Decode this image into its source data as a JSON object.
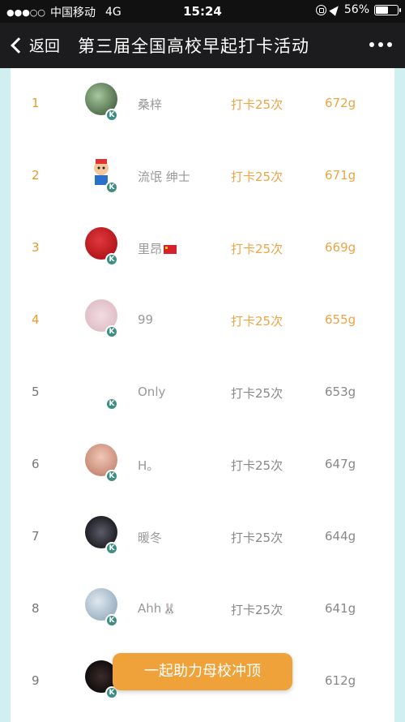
{
  "status_bar": {
    "signal": "●●●○○",
    "carrier": "中国移动",
    "network": "4G",
    "time": "15:24",
    "battery": "56%",
    "battery_level": 0.56
  },
  "nav": {
    "back_label": "返回",
    "title": "第三届全国高校早起打卡活动"
  },
  "rows": [
    {
      "rank": "1",
      "name": "桑梓",
      "checkin": "打卡25次",
      "grams": "672g"
    },
    {
      "rank": "2",
      "name": "流氓 绅士",
      "checkin": "打卡25次",
      "grams": "671g"
    },
    {
      "rank": "3",
      "name": "里昂",
      "checkin": "打卡25次",
      "grams": "669g"
    },
    {
      "rank": "4",
      "name": "99",
      "checkin": "打卡25次",
      "grams": "655g"
    },
    {
      "rank": "5",
      "name": "Only",
      "checkin": "打卡25次",
      "grams": "653g"
    },
    {
      "rank": "6",
      "name": "H。",
      "checkin": "打卡25次",
      "grams": "647g"
    },
    {
      "rank": "7",
      "name": "暖冬",
      "checkin": "打卡25次",
      "grams": "644g"
    },
    {
      "rank": "8",
      "name": "Ahh",
      "checkin": "打卡25次",
      "grams": "641g"
    },
    {
      "rank": "9",
      "name": "",
      "checkin": "",
      "grams": "612g"
    }
  ],
  "badge_letter": "K",
  "float_button": {
    "label": "一起助力母校冲顶"
  },
  "colors": {
    "accent_orange": "#eaa546",
    "rank_orange": "#e99a2c",
    "badge_teal": "#3f8e84",
    "background": "#cfeff0"
  }
}
